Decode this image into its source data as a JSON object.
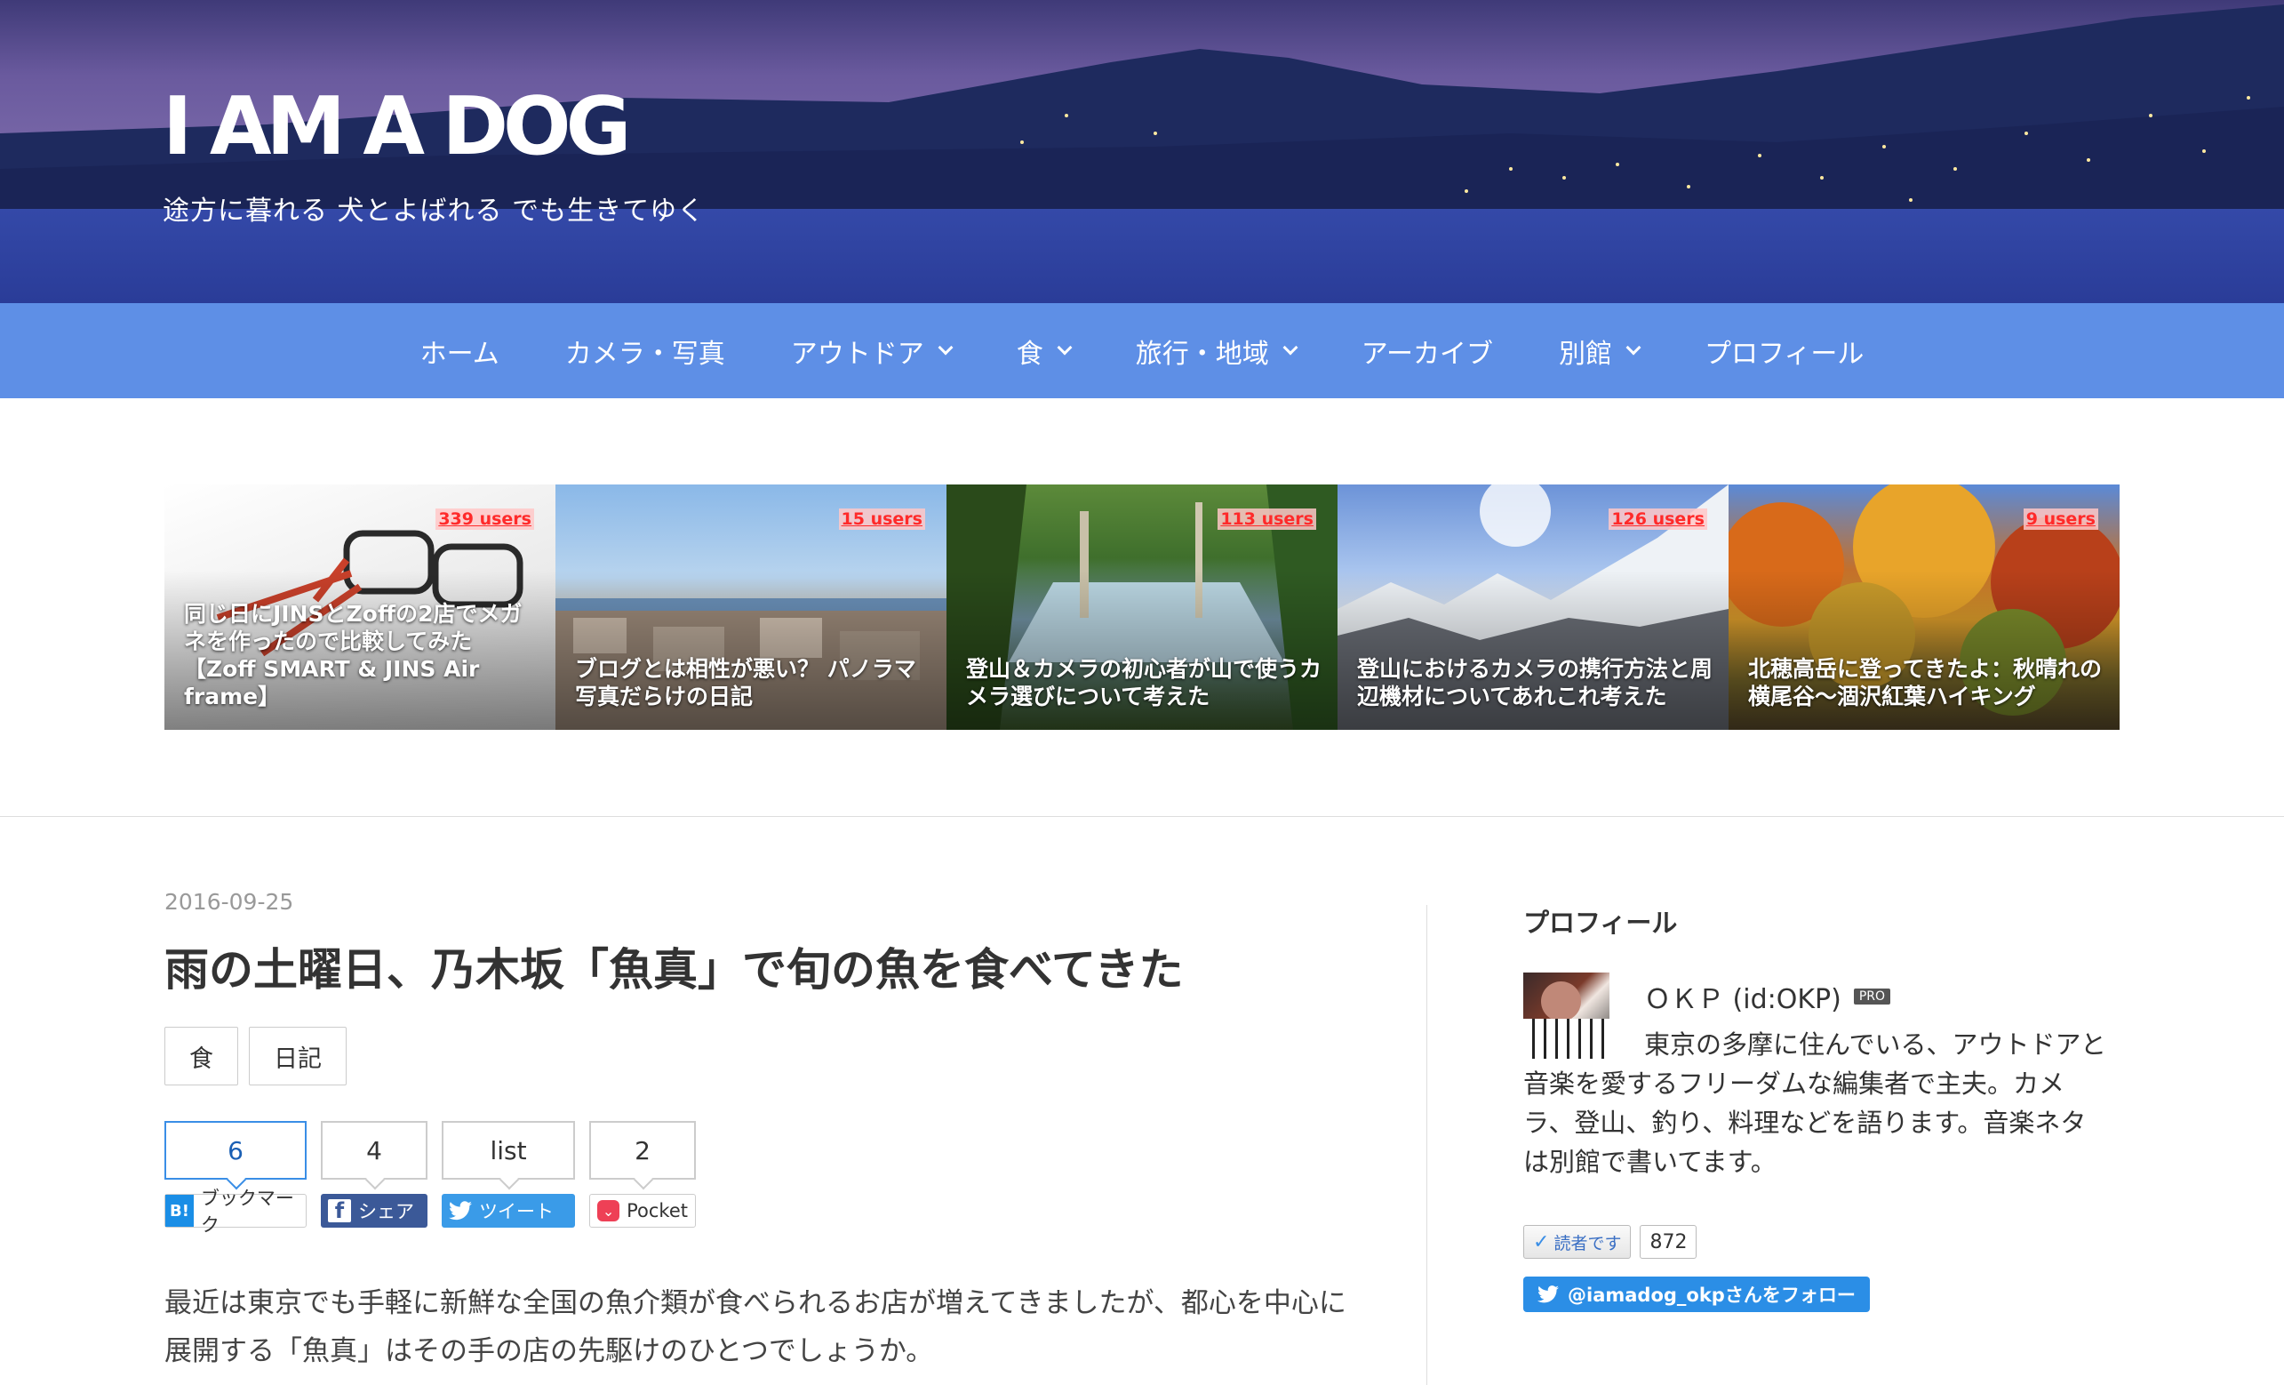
{
  "blog": {
    "title": "I AM A DOG",
    "description": "途方に暮れる 犬とよばれる でも生きてゆく"
  },
  "nav": {
    "items": [
      {
        "label": "ホーム",
        "dropdown": false
      },
      {
        "label": "カメラ・写真",
        "dropdown": false
      },
      {
        "label": "アウトドア",
        "dropdown": true
      },
      {
        "label": "食",
        "dropdown": true
      },
      {
        "label": "旅行・地域",
        "dropdown": true
      },
      {
        "label": "アーカイブ",
        "dropdown": false
      },
      {
        "label": "別館",
        "dropdown": true
      },
      {
        "label": "プロフィール",
        "dropdown": false
      }
    ]
  },
  "featured": [
    {
      "users": "339 users",
      "title": "同じ日にJINSとZoffの2店でメガネを作ったので比較してみた【Zoff SMART & JINS Air frame】"
    },
    {
      "users": "15 users",
      "title": "ブログとは相性が悪い？ パノラマ写真だらけの日記"
    },
    {
      "users": "113 users",
      "title": "登山＆カメラの初心者が山で使うカメラ選びについて考えた"
    },
    {
      "users": "126 users",
      "title": "登山におけるカメラの携行方法と周辺機材についてあれこれ考えた"
    },
    {
      "users": "9 users",
      "title": "北穂高岳に登ってきたよ：秋晴れの横尾谷〜涸沢紅葉ハイキング"
    }
  ],
  "article": {
    "date": "2016-09-25",
    "title": "雨の土曜日、乃木坂「魚真」で旬の魚を食べてきた",
    "categories": [
      "食",
      "日記"
    ],
    "share": {
      "hatena": {
        "count": "6",
        "label": "ブックマーク",
        "icon": "B!"
      },
      "facebook": {
        "count": "4",
        "label": "シェア",
        "icon": "f"
      },
      "twitter": {
        "count": "list",
        "label": "ツイート"
      },
      "pocket": {
        "count": "2",
        "label": "Pocket"
      }
    },
    "body": "最近は東京でも手軽に新鮮な全国の魚介類が食べられるお店が増えてきましたが、都心を中心に展開する「魚真」はその手の店の先駆けのひとつでしょうか。"
  },
  "sidebar": {
    "profile_heading": "プロフィール",
    "user_id": "ＯＫＰ (id:OKP)",
    "pro_badge": "PRO",
    "profile_text": "東京の多摩に住んでいる、アウトドアと音楽を愛するフリーダムな編集者で主夫。カメラ、登山、釣り、料理などを語ります。音楽ネタは別館で書いてます。",
    "reader_button": "読者です",
    "reader_count": "872",
    "follow_button": "@iamadog_okpさんをフォロー"
  },
  "colors": {
    "nav_bg": "#5e8fe6",
    "hatena_blue": "#1a8ee6",
    "facebook_blue": "#3b5998",
    "twitter_blue": "#3a9be8",
    "pocket_red": "#ee4056",
    "users_red": "#ff2a2a"
  }
}
